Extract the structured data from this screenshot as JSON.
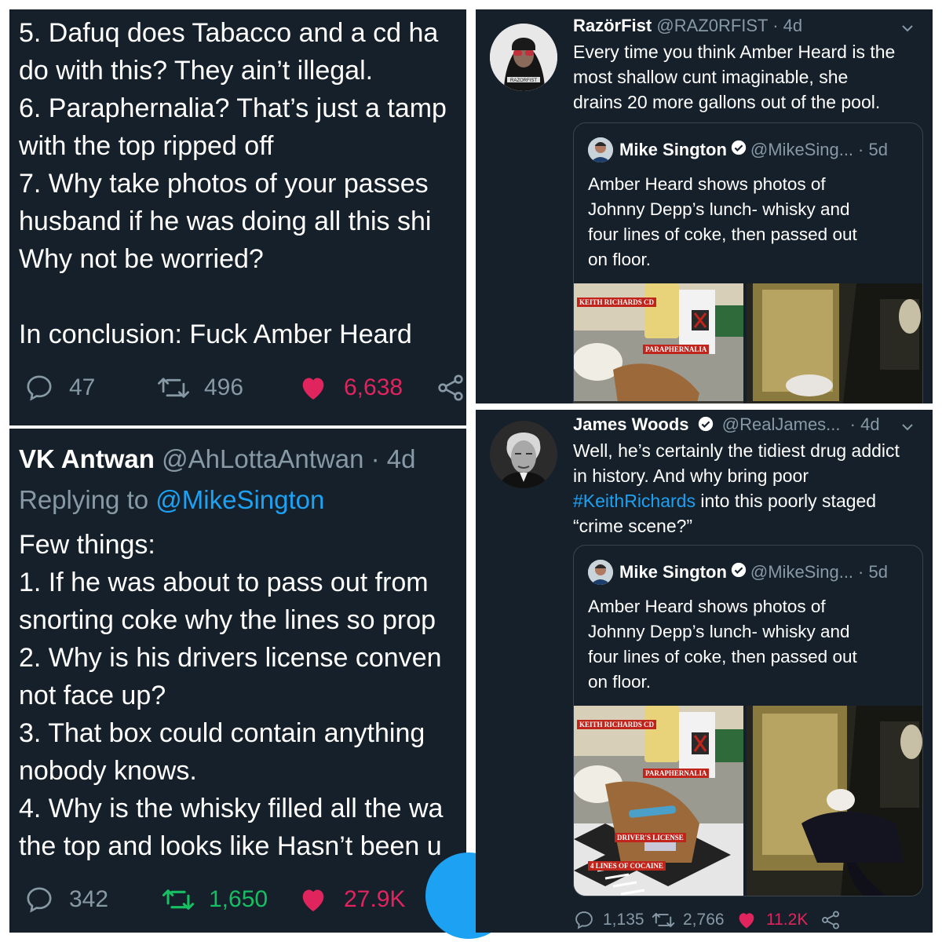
{
  "panel1": {
    "lines": [
      "5. Dafuq does Tabacco and a cd ha",
      "do with this? They ain’t illegal.",
      "6. Paraphernalia? That’s just a tamp",
      "with the top ripped off",
      "7. Why take photos of your passes",
      "husband if he was doing all this shi",
      "Why not be worried?",
      "",
      "In conclusion: Fuck Amber Heard"
    ],
    "replies": "47",
    "retweets": "496",
    "likes": "6,638"
  },
  "panel2": {
    "name": "VK Antwan",
    "handle": "@AhLottaAntwan",
    "time": "· 4d",
    "replying_prefix": "Replying to",
    "replying_handle": "@MikeSington",
    "lines": [
      "Few things:",
      "1. If he was about to pass out from",
      "snorting coke why the lines so prop",
      "2. Why is his drivers license conven",
      "not face up?",
      "3. That box could contain anything",
      "nobody knows.",
      "4. Why is the whisky filled all the wa",
      "the top and looks like Hasn’t been u"
    ],
    "replies": "342",
    "retweets": "1,650",
    "likes": "27.9K"
  },
  "panel3": {
    "name": "RazörFist",
    "handle": "@RAZ0RFIST",
    "time": "· 4d",
    "avatar_text": "RAZORFIST",
    "lines": [
      "Every time you think Amber Heard is the",
      "most shallow cunt imaginable, she",
      "drains 20 more gallons out of the pool."
    ],
    "quote": {
      "name": "Mike Sington",
      "handle": "@MikeSing...",
      "time": "· 5d",
      "lines": [
        "Amber Heard shows photos of",
        "Johnny Depp’s lunch- whisky and",
        "four lines of coke, then passed out",
        "on floor."
      ],
      "tags": [
        "KEITH RICHARDS CD",
        "PARAPHERNALIA"
      ]
    }
  },
  "panel4": {
    "name": "James Woods",
    "handle": "@RealJames...",
    "time": "· 4d",
    "lines": [
      "Well, he’s certainly the tidiest drug addict",
      "in history. And why bring poor"
    ],
    "hashtag": "#KeithRichards",
    "line3_rest": " into this poorly staged",
    "line4": "“crime scene?”",
    "quote": {
      "name": "Mike Sington",
      "handle": "@MikeSing...",
      "time": "· 5d",
      "lines": [
        "Amber Heard shows photos of",
        "Johnny Depp’s lunch- whisky and",
        "four lines of coke, then passed out",
        "on floor."
      ],
      "tags": [
        "KEITH RICHARDS CD",
        "PARAPHERNALIA",
        "DRIVER'S LICENSE",
        "4 LINES OF COCAINE"
      ]
    },
    "replies": "1,135",
    "retweets": "2,766",
    "likes": "11.2K"
  },
  "colors": {
    "background": "#15202b",
    "border": "#38444d",
    "muted": "#8899a6",
    "like": "#e0245e",
    "retweet_active": "#17bf63",
    "link": "#1da1f2"
  },
  "icons": [
    "reply-icon",
    "retweet-icon",
    "heart-icon",
    "share-icon",
    "chevron-down-icon",
    "verified-badge-icon"
  ]
}
